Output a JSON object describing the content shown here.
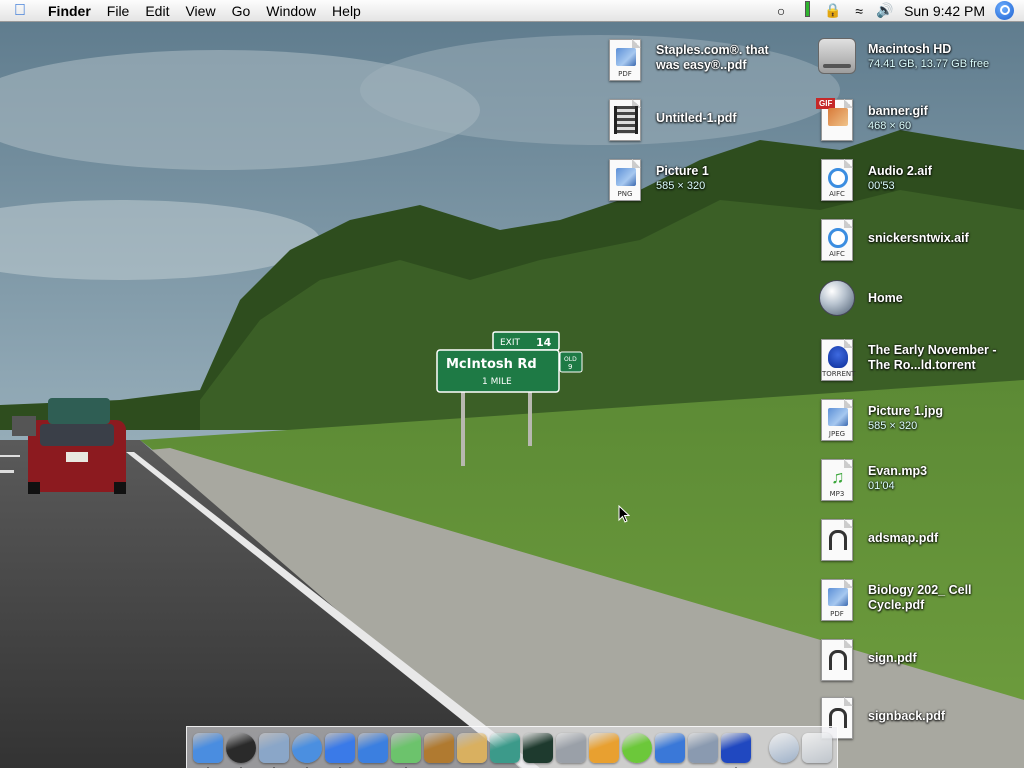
{
  "menubar": {
    "apple_glyph": "",
    "app_name": "Finder",
    "menus": [
      "File",
      "Edit",
      "View",
      "Go",
      "Window",
      "Help"
    ],
    "clock": "Sun 9:42 PM",
    "extras": [
      "ichat-status-icon",
      "battery-icon",
      "keychain-lock-icon",
      "wifi-icon",
      "volume-icon"
    ]
  },
  "desktop_icons": [
    {
      "name": "Staples.com®. that was easy®..pdf",
      "info": "",
      "kind": "PDF",
      "icon": "pdf-document-icon"
    },
    {
      "name": "Untitled-1.pdf",
      "info": "",
      "kind": "",
      "icon": "film-pdf-icon"
    },
    {
      "name": "Picture 1",
      "info": "585 × 320",
      "kind": "PNG",
      "icon": "png-image-icon"
    },
    {
      "name": "Macintosh HD",
      "info": "74.41 GB, 13.77 GB free",
      "kind": "",
      "icon": "hard-drive-icon"
    },
    {
      "name": "banner.gif",
      "info": "468 × 60",
      "kind": "GIF",
      "icon": "gif-image-icon"
    },
    {
      "name": "Audio 2.aif",
      "info": "00'53",
      "kind": "AIFC",
      "icon": "aiff-audio-icon"
    },
    {
      "name": "snickersntwix.aif",
      "info": "",
      "kind": "AIFC",
      "icon": "aiff-audio-icon"
    },
    {
      "name": "Home",
      "info": "",
      "kind": "",
      "icon": "home-alias-icon"
    },
    {
      "name": "The Early November - The Ro...ld.torrent",
      "info": "",
      "kind": "TORRENT",
      "icon": "torrent-file-icon"
    },
    {
      "name": "Picture 1.jpg",
      "info": "585 × 320",
      "kind": "JPEG",
      "icon": "jpeg-image-icon"
    },
    {
      "name": "Evan.mp3",
      "info": "01'04",
      "kind": "MP3",
      "icon": "mp3-audio-icon"
    },
    {
      "name": "adsmap.pdf",
      "info": "",
      "kind": "",
      "icon": "plug-pdf-icon"
    },
    {
      "name": "Biology 202_ Cell Cycle.pdf",
      "info": "",
      "kind": "PDF",
      "icon": "pdf-document-icon"
    },
    {
      "name": "sign.pdf",
      "info": "",
      "kind": "",
      "icon": "plug-pdf-icon"
    },
    {
      "name": "signback.pdf",
      "info": "",
      "kind": "",
      "icon": "plug-pdf-icon"
    }
  ],
  "wallpaper_sign": {
    "exit_label": "EXIT",
    "exit_number": "14",
    "road_name": "McIntosh Rd",
    "distance": "1 MILE",
    "old_label": "OLD",
    "old_number": "9"
  },
  "dock": {
    "apps": [
      {
        "name": "finder",
        "color": "#4a8de0",
        "running": true
      },
      {
        "name": "dashboard",
        "color": "#2a2a2a",
        "running": true
      },
      {
        "name": "mail",
        "color": "#8aa6c8",
        "running": true
      },
      {
        "name": "safari",
        "color": "#4b8fe0",
        "running": true
      },
      {
        "name": "ichat",
        "color": "#3a7ae8",
        "running": true
      },
      {
        "name": "word",
        "color": "#3b7fe0",
        "running": false
      },
      {
        "name": "itunes",
        "color": "#6cc36c",
        "running": true
      },
      {
        "name": "iphoto",
        "color": "#b07a30",
        "running": false
      },
      {
        "name": "address-book",
        "color": "#d9b060",
        "running": false
      },
      {
        "name": "itunes-store",
        "color": "#3c9a8a",
        "running": false
      },
      {
        "name": "activity-monitor",
        "color": "#1e3a2e",
        "running": false
      },
      {
        "name": "system-preferences",
        "color": "#9aa0a8",
        "running": false
      },
      {
        "name": "transmit",
        "color": "#e8a030",
        "running": false
      },
      {
        "name": "dreamweaver",
        "color": "#6cc83a",
        "running": false
      },
      {
        "name": "feather-app",
        "color": "#3a78d8",
        "running": false
      },
      {
        "name": "bbedit",
        "color": "#8a9ab0",
        "running": false
      },
      {
        "name": "azureus",
        "color": "#2048c0",
        "running": true
      }
    ],
    "extras": [
      {
        "name": "network-globe",
        "color": "#9db0c8"
      },
      {
        "name": "trash",
        "color": "#bfc5cc"
      }
    ]
  }
}
